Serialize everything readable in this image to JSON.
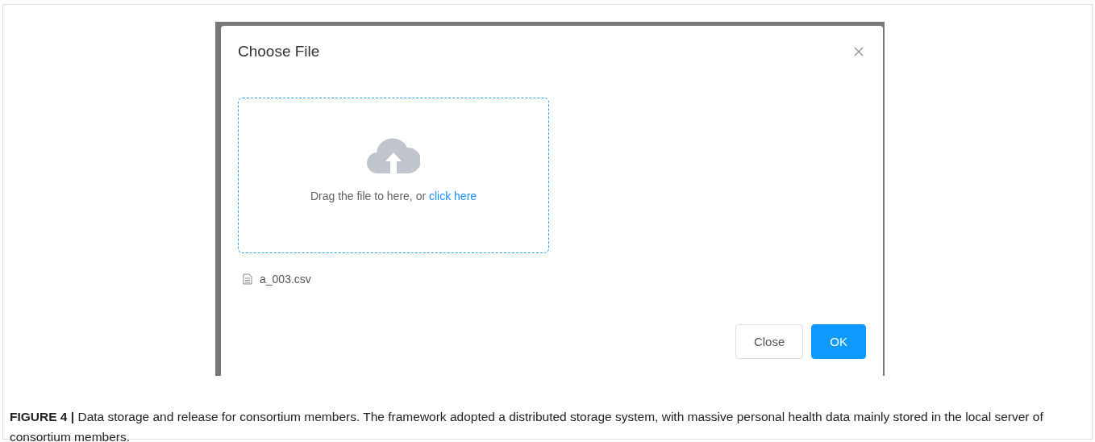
{
  "dialog": {
    "title": "Choose File",
    "upload": {
      "prompt": "Drag the file to here, or",
      "link": "click here"
    },
    "files": [
      {
        "name": "a_003.csv"
      }
    ],
    "buttons": [
      {
        "label": "Close",
        "kind": "default"
      },
      {
        "label": "OK",
        "kind": "primary"
      }
    ]
  },
  "caption": "**FIGURE 4 |** Data storage and release for consortium members. The framework adopted a distributed storage system, with massive personal health data mainly stored in the local server of consortium members."
}
